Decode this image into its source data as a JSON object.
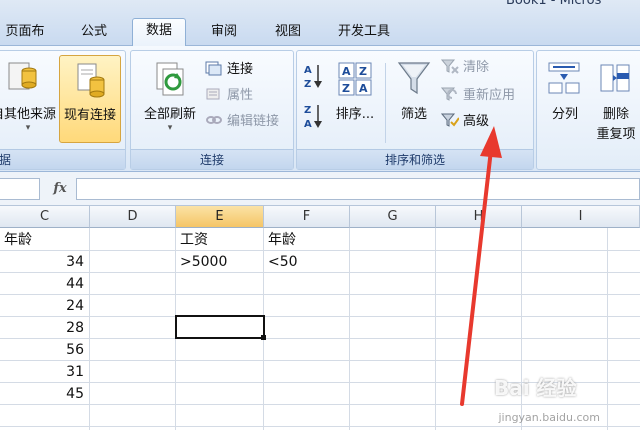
{
  "window": {
    "title": "Book1 - Micros"
  },
  "tabs": [
    {
      "label": "页面布局",
      "active": false
    },
    {
      "label": "公式",
      "active": false
    },
    {
      "label": "数据",
      "active": true
    },
    {
      "label": "审阅",
      "active": false
    },
    {
      "label": "视图",
      "active": false
    },
    {
      "label": "开发工具",
      "active": false
    }
  ],
  "ribbon": {
    "get_external": {
      "other_sources": "自其他来源",
      "existing_connections": "现有连接",
      "group_label": "据"
    },
    "connections": {
      "refresh_all": "全部刷新",
      "connect": "连接",
      "properties": "属性",
      "edit_links": "编辑链接",
      "group_label": "连接"
    },
    "sort_filter": {
      "sort": "排序...",
      "filter": "筛选",
      "clear": "清除",
      "reapply": "重新应用",
      "advanced": "高级",
      "group_label": "排序和筛选"
    },
    "data_tools": {
      "text_to_columns": "分列",
      "remove_duplicates_1": "删除",
      "remove_duplicates_2": "重复项"
    }
  },
  "formula_bar": {
    "fx_symbol": "fx",
    "value": ""
  },
  "columns": [
    {
      "label": "C",
      "selected": false
    },
    {
      "label": "D",
      "selected": false
    },
    {
      "label": "E",
      "selected": true
    },
    {
      "label": "F",
      "selected": false
    },
    {
      "label": "G",
      "selected": false
    },
    {
      "label": "H",
      "selected": false
    },
    {
      "label": "I",
      "selected": false
    }
  ],
  "cells": {
    "c_header": "年龄",
    "c_values": [
      "34",
      "44",
      "24",
      "28",
      "56",
      "31",
      "45"
    ],
    "e_header": "工资",
    "e_criteria": ">5000",
    "f_header": "年龄",
    "f_criteria": "<50"
  },
  "watermark": {
    "brand": "Bai 经验",
    "url": "jingyan.baidu.com"
  },
  "colors": {
    "accent": "#ffd97a",
    "arrow": "#e8392e",
    "ribbon_blue": "#c9daf0"
  }
}
